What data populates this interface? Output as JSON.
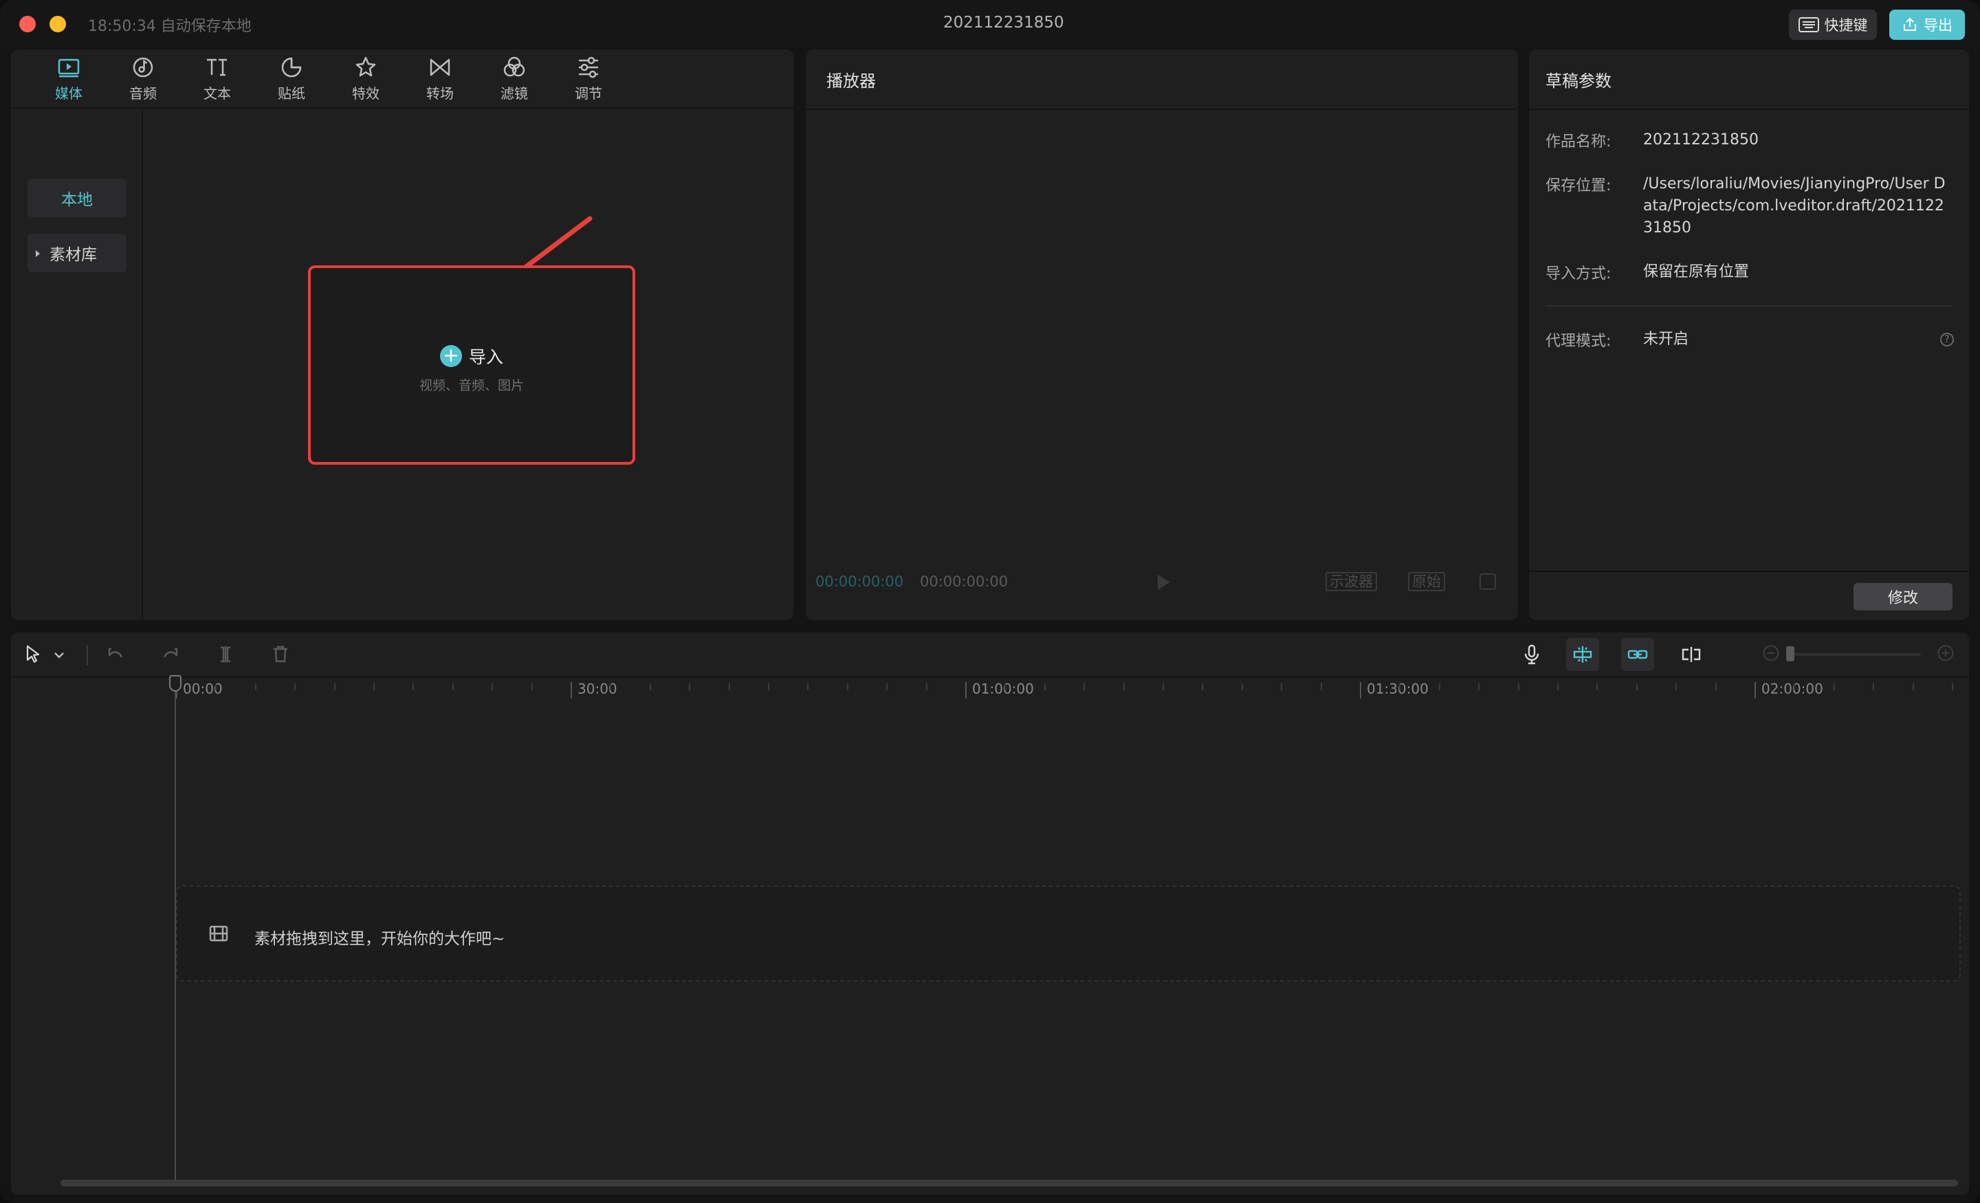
{
  "window": {
    "autosave": "18:50:34 自动保存本地",
    "title": "202112231850",
    "shortcut_label": "快捷键",
    "export_label": "导出"
  },
  "media_tabs": [
    {
      "label": "媒体",
      "icon": "media-icon",
      "active": true
    },
    {
      "label": "音频",
      "icon": "audio-icon"
    },
    {
      "label": "文本",
      "icon": "text-icon"
    },
    {
      "label": "贴纸",
      "icon": "sticker-icon"
    },
    {
      "label": "特效",
      "icon": "effects-icon"
    },
    {
      "label": "转场",
      "icon": "transition-icon"
    },
    {
      "label": "滤镜",
      "icon": "filter-icon"
    },
    {
      "label": "调节",
      "icon": "adjust-icon"
    }
  ],
  "sidebar": {
    "local": "本地",
    "library": "素材库"
  },
  "import": {
    "title": "导入",
    "subtitle": "视频、音频、图片"
  },
  "player": {
    "title": "播放器",
    "current_time": "00:00:00:00",
    "total_time": "00:00:00:00",
    "scope_btn": "示波器",
    "original_btn": "原始"
  },
  "params": {
    "title": "草稿参数",
    "rows": [
      {
        "label": "作品名称:",
        "value": "202112231850"
      },
      {
        "label": "保存位置:",
        "value": "/Users/loraliu/Movies/JianyingPro/User Data/Projects/com.lveditor.draft/202112231850"
      },
      {
        "label": "导入方式:",
        "value": "保留在原有位置"
      },
      {
        "label": "代理模式:",
        "value": "未开启"
      }
    ],
    "modify_label": "修改"
  },
  "timeline": {
    "ticks": [
      "00:00",
      "30:00",
      "01:00:00",
      "01:30:00",
      "02:00:00"
    ],
    "drop_hint": "素材拖拽到这里，开始你的大作吧~"
  },
  "colors": {
    "accent": "#56c4d0",
    "highlight": "#e6403b"
  }
}
